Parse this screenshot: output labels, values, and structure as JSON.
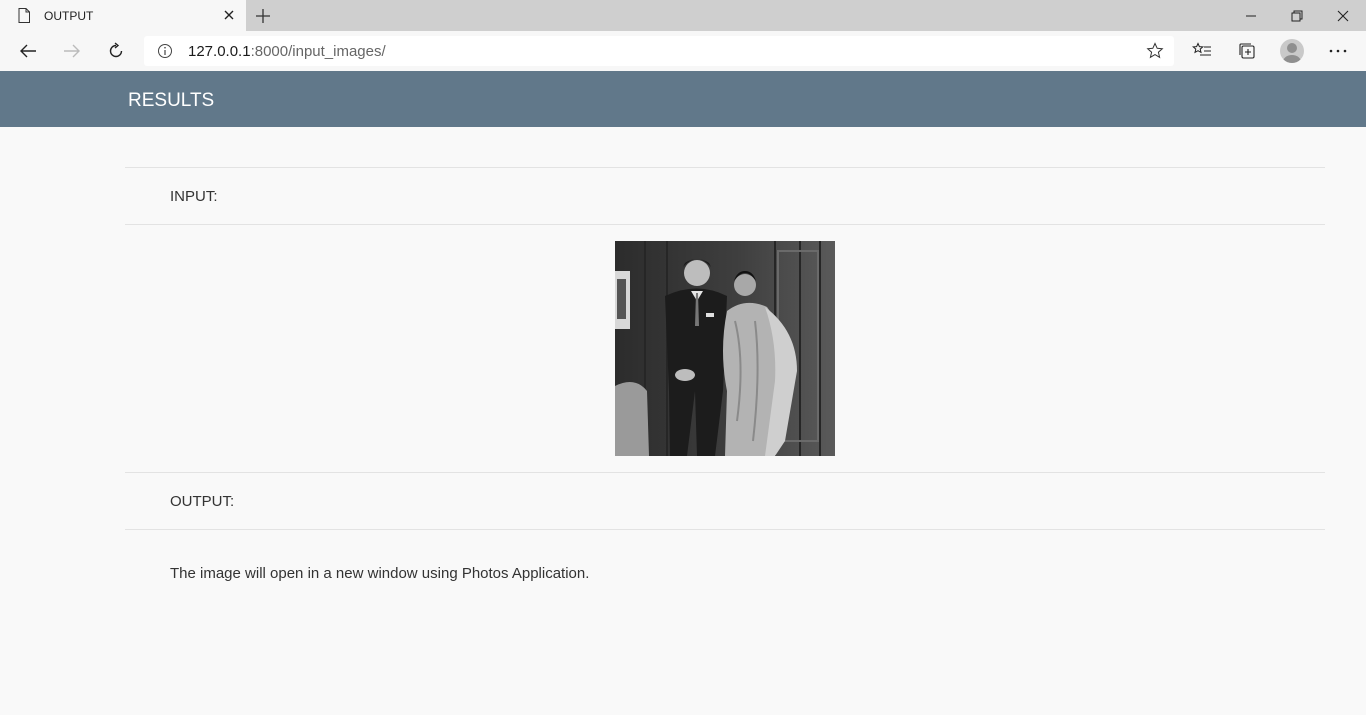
{
  "browser": {
    "tab_title": "OUTPUT",
    "url_host": "127.0.0.1",
    "url_rest": ":8000/input_images/"
  },
  "page": {
    "header_title": "RESULTS",
    "input_label": "INPUT:",
    "output_label": "OUTPUT:",
    "message": "The image will open in a new window using Photos Application."
  },
  "colors": {
    "header_bg": "#61788a",
    "page_bg": "#f9f9f9"
  }
}
